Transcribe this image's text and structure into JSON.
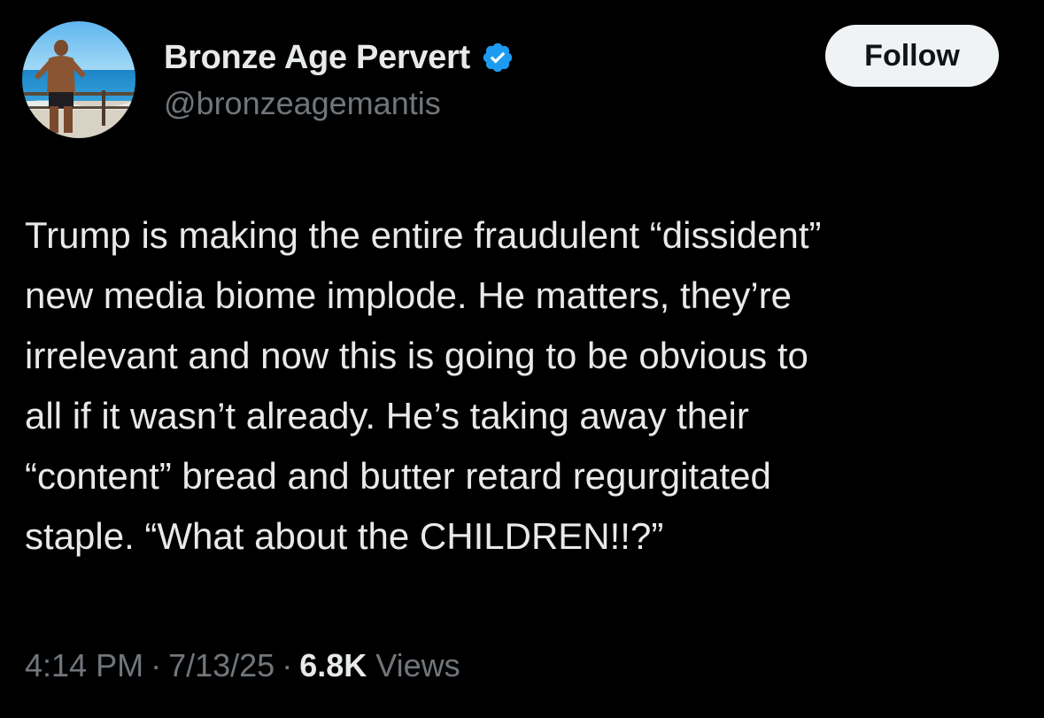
{
  "author": {
    "display_name": "Bronze Age Pervert",
    "handle": "@bronzeagemantis",
    "verified": true,
    "verified_color": "#1d9bf0",
    "avatar_icon": "profile-photo-beach"
  },
  "follow_button": {
    "label": "Follow"
  },
  "tweet": {
    "text_lines": [
      "Trump is making the entire fraudulent “dissident”",
      "new media biome implode. He matters, they’re",
      "irrelevant and now this is going to be obvious to",
      "all if it wasn’t already. He’s taking away their",
      "“content” bread and butter retard regurgitated",
      "staple. “What about the CHILDREN!!?”"
    ]
  },
  "meta": {
    "time": "4:14 PM",
    "separator": "·",
    "date": "7/13/25",
    "views_count": "6.8K",
    "views_label": "Views"
  },
  "colors": {
    "background": "#000000",
    "primary_text": "#e7e9ea",
    "secondary_text": "#71767b",
    "button_bg": "#eff3f4"
  }
}
